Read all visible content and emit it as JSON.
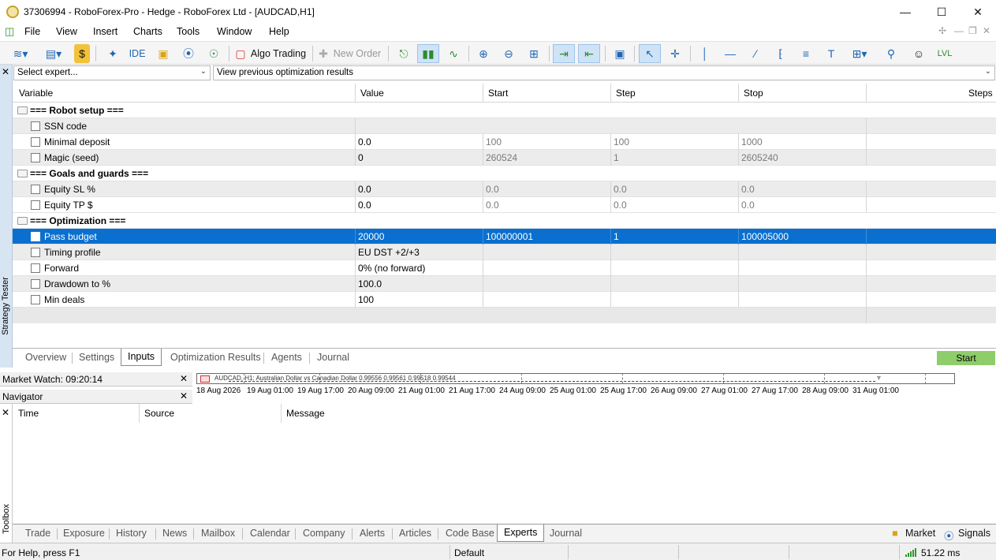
{
  "window": {
    "title": "37306994 - RoboForex-Pro - Hedge - RoboForex Ltd - [AUDCAD,H1]"
  },
  "menu": [
    "File",
    "View",
    "Insert",
    "Charts",
    "Tools",
    "Window",
    "Help"
  ],
  "toolbar": {
    "ide": "IDE",
    "algo_trading": "Algo Trading",
    "new_order": "New Order"
  },
  "tester": {
    "expert_placeholder": "Select expert...",
    "optimization_results": "View previous optimization results",
    "columns": [
      "Variable",
      "Value",
      "Start",
      "Step",
      "Stop",
      "Steps"
    ],
    "rows": [
      {
        "variable": "=== Robot setup ===",
        "value": "",
        "start": "",
        "step": "",
        "stop": "",
        "group": true
      },
      {
        "variable": "SSN code",
        "value": "",
        "start": "",
        "step": "",
        "stop": ""
      },
      {
        "variable": "Minimal deposit",
        "value": "0.0",
        "start": "100",
        "step": "100",
        "stop": "1000"
      },
      {
        "variable": "Magic (seed)",
        "value": "0",
        "start": "260524",
        "step": "1",
        "stop": "2605240"
      },
      {
        "variable": "=== Goals and guards ===",
        "value": "",
        "start": "",
        "step": "",
        "stop": "",
        "group": true
      },
      {
        "variable": "Equity SL %",
        "value": "0.0",
        "start": "0.0",
        "step": "0.0",
        "stop": "0.0"
      },
      {
        "variable": "Equity TP $",
        "value": "0.0",
        "start": "0.0",
        "step": "0.0",
        "stop": "0.0"
      },
      {
        "variable": "=== Optimization ===",
        "value": "",
        "start": "",
        "step": "",
        "stop": "",
        "group": true
      },
      {
        "variable": "Pass budget",
        "value": "20000",
        "start": "100000001",
        "step": "1",
        "stop": "100005000",
        "selected": true
      },
      {
        "variable": "Timing profile",
        "value": "EU DST +2/+3",
        "start": "",
        "step": "",
        "stop": ""
      },
      {
        "variable": "Forward",
        "value": "0% (no forward)",
        "start": "",
        "step": "",
        "stop": ""
      },
      {
        "variable": "Drawdown to %",
        "value": "100.0",
        "start": "",
        "step": "",
        "stop": ""
      },
      {
        "variable": "Min deals",
        "value": "100",
        "start": "",
        "step": "",
        "stop": ""
      }
    ],
    "tabs": [
      "Overview",
      "Settings",
      "Inputs",
      "Optimization Results",
      "Agents",
      "Journal"
    ],
    "active_tab": "Inputs",
    "start_label": "Start",
    "side_label": "Strategy Tester"
  },
  "market_watch": {
    "title": "Market Watch: 09:20:14"
  },
  "navigator": {
    "title": "Navigator"
  },
  "mini_chart": {
    "caption": "AUDCAD, H1: Australian Dollar vs Canadian Dollar  0.99556 0.99561 0.99518 0.99544",
    "dates": [
      "18 Aug 2026",
      "19 Aug 01:00",
      "19 Aug 17:00",
      "20 Aug 09:00",
      "21 Aug 01:00",
      "21 Aug 17:00",
      "24 Aug 09:00",
      "25 Aug 01:00",
      "25 Aug 17:00",
      "26 Aug 09:00",
      "27 Aug 01:00",
      "27 Aug 17:00",
      "28 Aug 09:00",
      "31 Aug 01:00"
    ]
  },
  "toolbox": {
    "side_label": "Toolbox",
    "columns": [
      "Time",
      "Source",
      "Message"
    ],
    "tabs": [
      "Trade",
      "Exposure",
      "History",
      "News",
      "Mailbox",
      "Calendar",
      "Company",
      "Alerts",
      "Articles",
      "Code Base",
      "Experts",
      "Journal"
    ],
    "active_tab": "Experts",
    "market_label": "Market",
    "signals_label": "Signals"
  },
  "statusbar": {
    "help": "For Help, press F1",
    "profile": "Default",
    "ping": "51.22 ms"
  },
  "colors": {
    "selection": "#0a6fcf",
    "start": "#8fcd6b",
    "tester_side": "#d7e4f2"
  }
}
